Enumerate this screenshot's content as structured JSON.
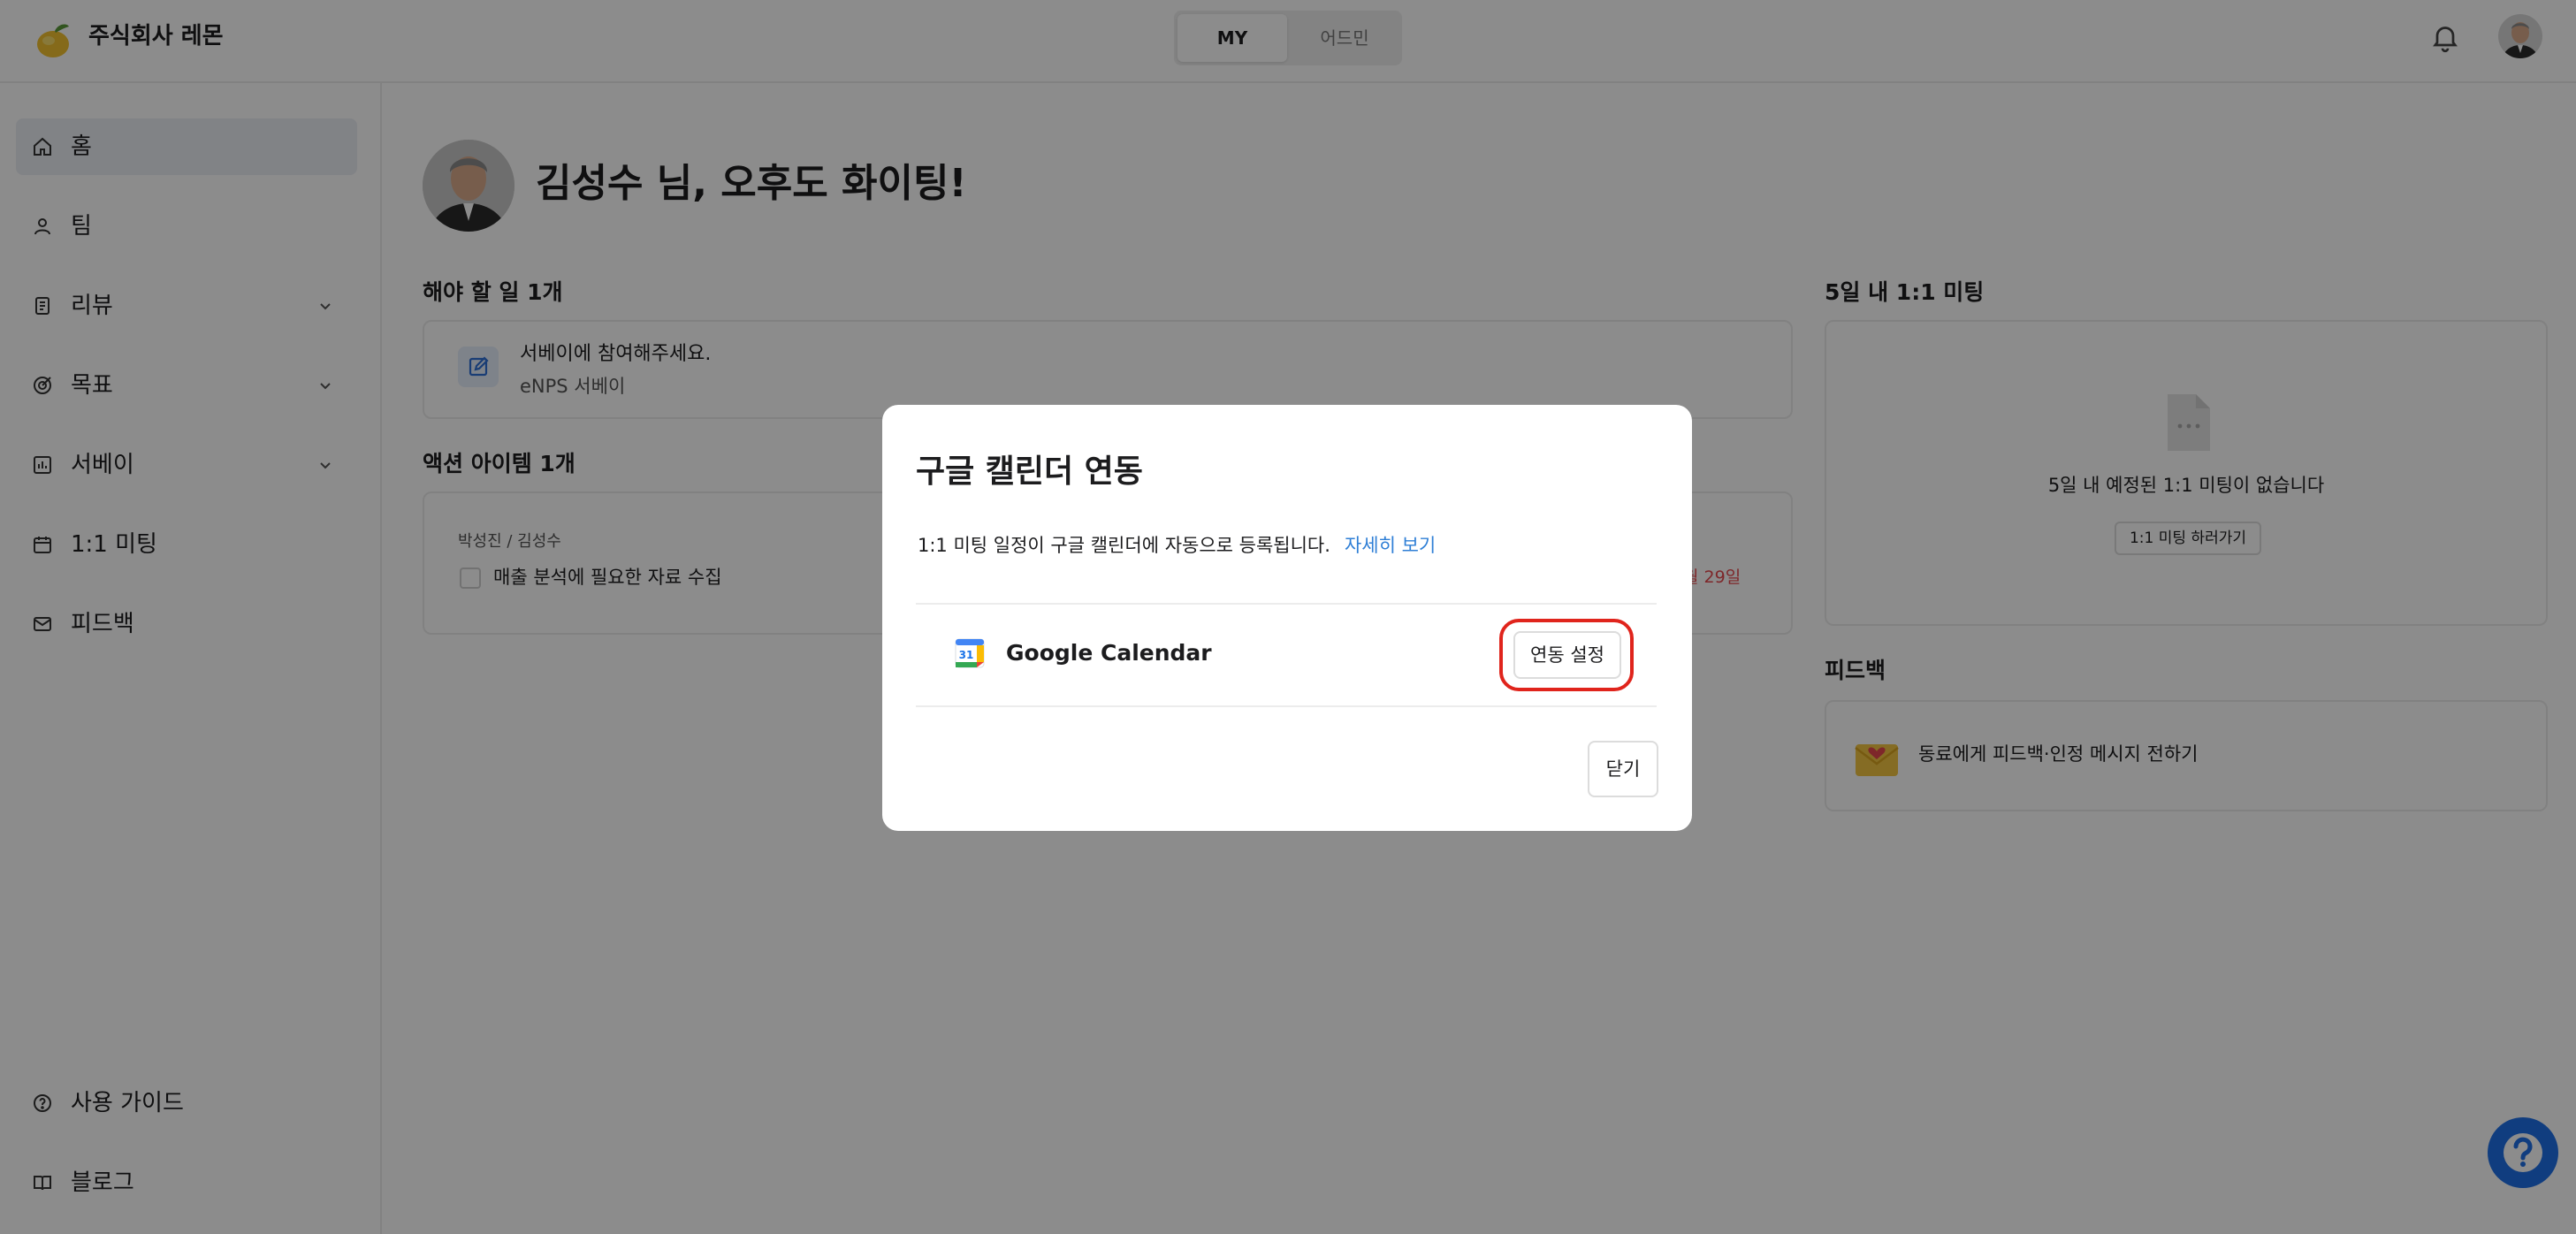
{
  "header": {
    "company_name": "주식회사 레몬",
    "segment": {
      "my_label": "MY",
      "admin_label": "어드민",
      "selected": "MY"
    },
    "logo_icon": "lemon-logo",
    "notification_icon": "bell-icon"
  },
  "sidebar": {
    "items": [
      {
        "label": "홈",
        "icon": "home-icon",
        "active": true,
        "expandable": false
      },
      {
        "label": "팀",
        "icon": "user-icon",
        "active": false,
        "expandable": false
      },
      {
        "label": "리뷰",
        "icon": "document-icon",
        "active": false,
        "expandable": true
      },
      {
        "label": "목표",
        "icon": "target-icon",
        "active": false,
        "expandable": true
      },
      {
        "label": "서베이",
        "icon": "chart-icon",
        "active": false,
        "expandable": true
      },
      {
        "label": "1:1 미팅",
        "icon": "calendar-icon",
        "active": false,
        "expandable": false
      },
      {
        "label": "피드백",
        "icon": "mail-icon",
        "active": false,
        "expandable": false
      }
    ],
    "bottom_items": [
      {
        "label": "사용 가이드",
        "icon": "help-circle-icon"
      },
      {
        "label": "블로그",
        "icon": "book-icon"
      }
    ]
  },
  "main": {
    "greeting": "김성수 님, 오후도 화이팅!",
    "todo": {
      "title": "해야 할 일 1개",
      "item_title": "서베이에 참여해주세요.",
      "item_subtitle": "eNPS 서베이"
    },
    "action_items": {
      "title": "액션 아이템 1개",
      "owners": "박성진 / 김성수",
      "item": "매출 분석에 필요한 자료 수집",
      "due_fragment": "월 29일"
    },
    "meetings": {
      "title": "5일 내 1:1 미팅",
      "empty_text": "5일 내 예정된 1:1 미팅이 없습니다",
      "button": "1:1 미팅 하러가기"
    },
    "feedback": {
      "title": "피드백",
      "item": "동료에게 피드백·인정 메시지 전하기"
    }
  },
  "modal": {
    "title": "구글 캘린더 연동",
    "description": "1:1 미팅 일정이 구글 캘린더에 자동으로 등록됩니다.",
    "link": "자세히 보기",
    "integration_name": "Google Calendar",
    "calendar_day": "31",
    "connect_button": "연동 설정",
    "close_button": "닫기"
  },
  "colors": {
    "accent": "#2f7fd6",
    "highlight_ring": "#e0241c",
    "help_fab": "#1e6fe8",
    "due_red": "#e5484d"
  }
}
